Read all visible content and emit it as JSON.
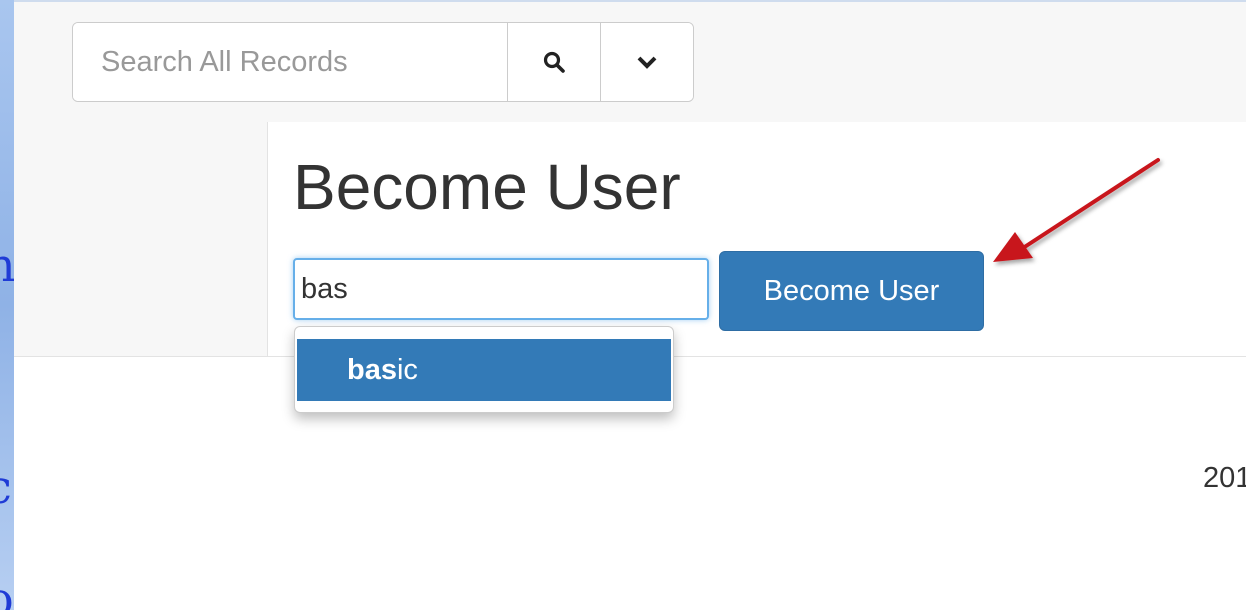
{
  "search": {
    "placeholder": "Search All Records",
    "search_icon": "search-icon",
    "dropdown_icon": "chevron-down-icon"
  },
  "page": {
    "title": "Become User"
  },
  "become_user": {
    "input_value": "bas",
    "button_label": "Become User"
  },
  "autocomplete": {
    "items": [
      {
        "match": "bas",
        "rest": "ic"
      }
    ]
  },
  "footer": {
    "text": "201"
  },
  "annotation": {
    "arrow_color": "#c8161d"
  },
  "background_glyphs": [
    "n",
    "c",
    "o"
  ],
  "colors": {
    "primary": "#337ab7",
    "focus_border": "#66afe9"
  }
}
